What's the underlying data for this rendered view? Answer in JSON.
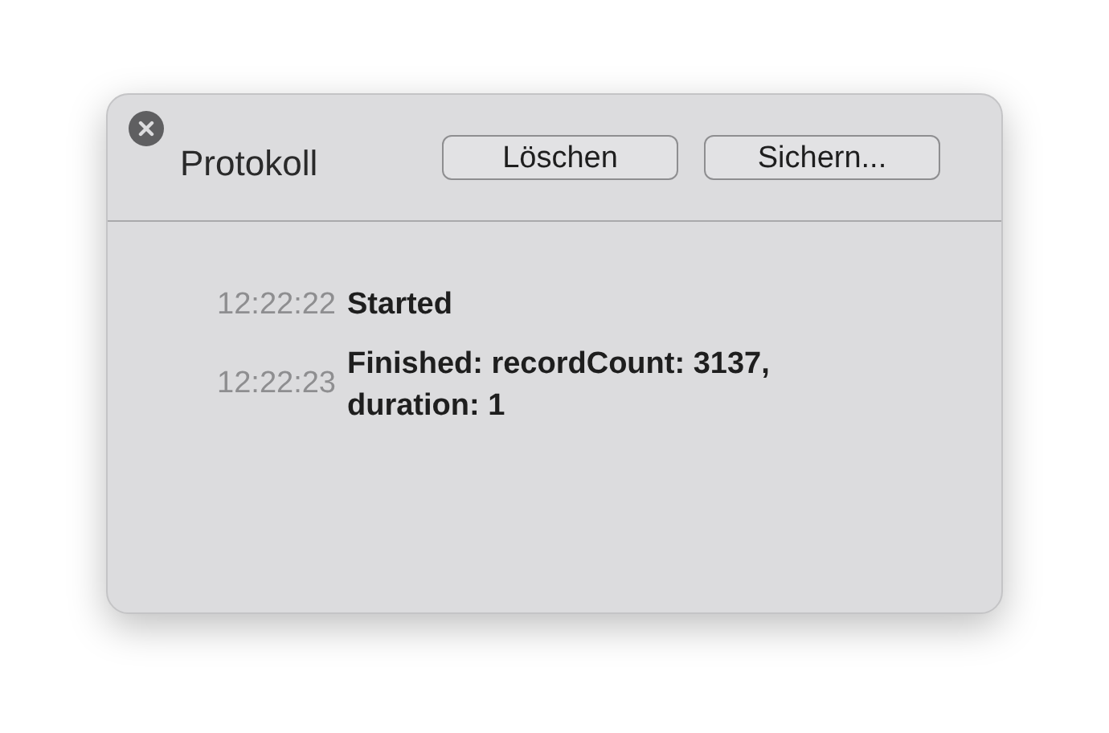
{
  "window": {
    "title": "Protokoll"
  },
  "buttons": [
    "Löschen",
    "Sichern..."
  ],
  "log": [
    {
      "time": "12:22:22",
      "message": "Started"
    },
    {
      "time": "12:22:23",
      "message": "Finished: recordCount: 3137, duration: 1"
    }
  ]
}
